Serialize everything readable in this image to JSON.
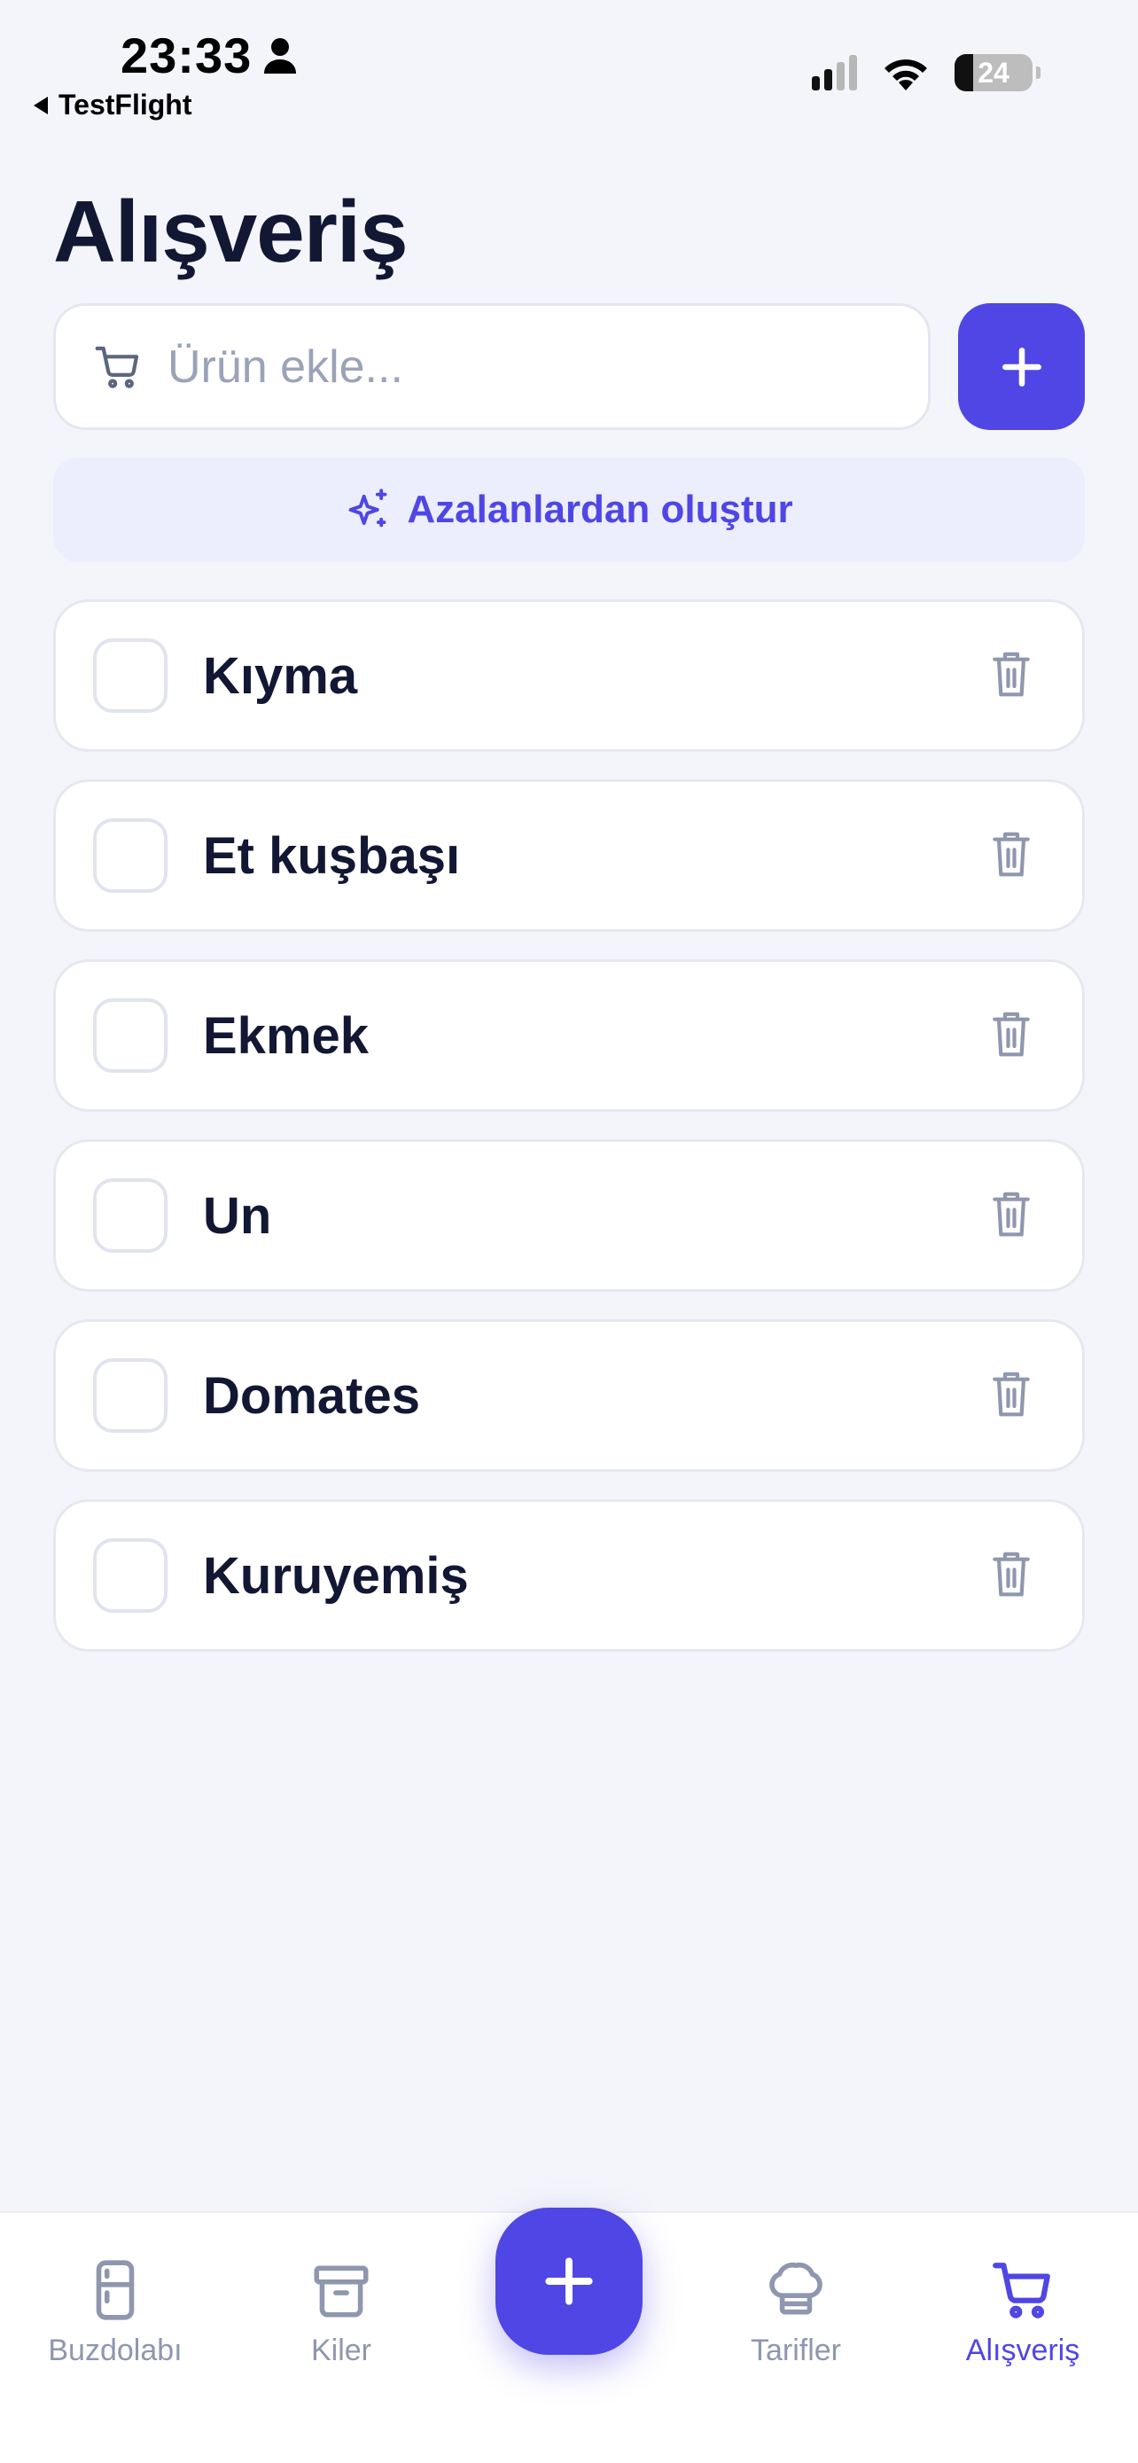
{
  "status": {
    "time": "23:33",
    "back_app": "TestFlight",
    "battery": "24"
  },
  "page": {
    "title": "Alışveriş"
  },
  "add_input": {
    "placeholder": "Ürün ekle..."
  },
  "generate_button": {
    "label": "Azalanlardan oluştur"
  },
  "items": [
    {
      "label": "Kıyma",
      "checked": false
    },
    {
      "label": "Et kuşbaşı",
      "checked": false
    },
    {
      "label": "Ekmek",
      "checked": false
    },
    {
      "label": "Un",
      "checked": false
    },
    {
      "label": "Domates",
      "checked": false
    },
    {
      "label": "Kuruyemiş",
      "checked": false
    }
  ],
  "tabbar": {
    "tabs": [
      {
        "label": "Buzdolabı",
        "icon": "fridge-icon"
      },
      {
        "label": "Kiler",
        "icon": "archive-box-icon"
      },
      {
        "label": "Tarifler",
        "icon": "chef-hat-icon"
      },
      {
        "label": "Alışveriş",
        "icon": "cart-icon",
        "active": true
      }
    ],
    "fab_icon": "plus-icon"
  },
  "colors": {
    "accent": "#4f46e5",
    "background": "#f4f5fa",
    "text": "#121833",
    "muted": "#8e97ae"
  }
}
